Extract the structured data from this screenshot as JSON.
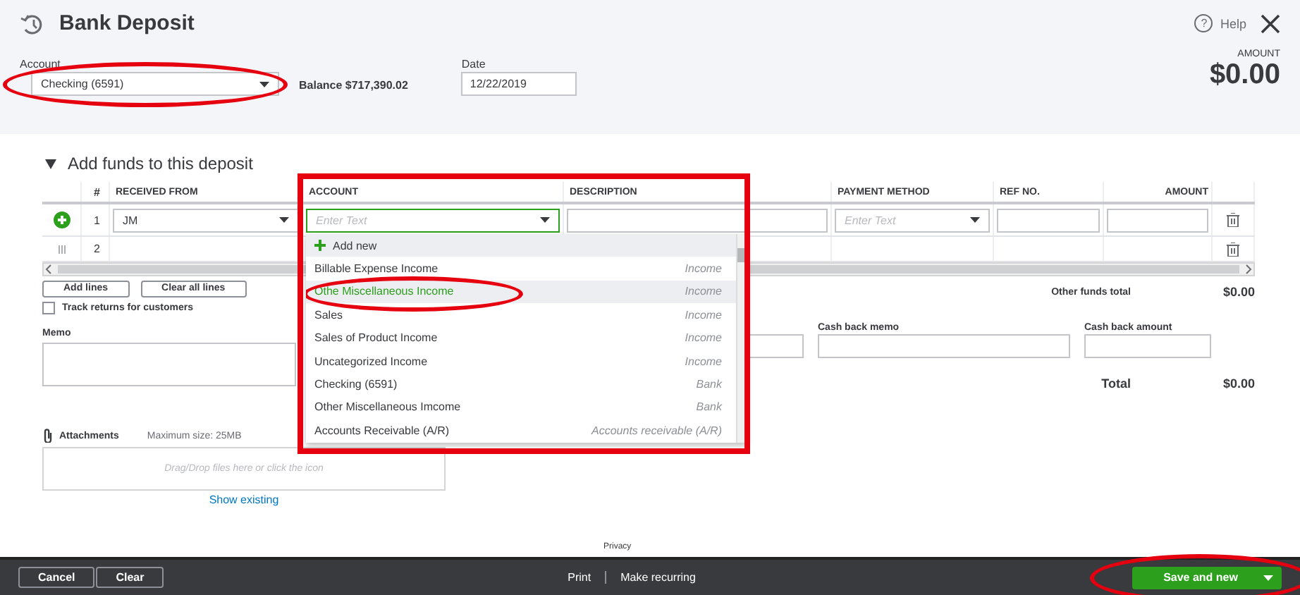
{
  "window": {
    "title": "Bank Deposit",
    "help_icon": "?",
    "help": "Help"
  },
  "header": {
    "account": {
      "label": "Account",
      "value": "Checking (6591)",
      "highlighted": true
    },
    "balance": "Balance $717,390.02",
    "date": {
      "label": "Date",
      "value": "12/22/2019"
    },
    "amount": {
      "label": "AMOUNT",
      "value": "$0.00"
    }
  },
  "section": {
    "title": "Add funds to this deposit",
    "expanded": true
  },
  "table": {
    "columns": [
      "#",
      "RECEIVED FROM",
      "ACCOUNT",
      "DESCRIPTION",
      "PAYMENT METHOD",
      "REF NO.",
      "AMOUNT"
    ],
    "rows": [
      {
        "number": "1",
        "received_from": "JM",
        "account_placeholder": "Enter Text",
        "payment_placeholder": "Enter Text",
        "editing": true
      },
      {
        "number": "2",
        "editing": false
      }
    ]
  },
  "dropdown": {
    "items": [
      {
        "kind": "add",
        "label": "Add new",
        "selected": false,
        "highlighted": false
      },
      {
        "kind": "option",
        "label": "Billable Expense Income",
        "type": "Income",
        "selected": false,
        "highlighted": false
      },
      {
        "kind": "option",
        "label": "Othe Miscellaneous Income",
        "type": "Income",
        "selected": true,
        "highlighted": true
      },
      {
        "kind": "option",
        "label": "Sales",
        "type": "Income",
        "selected": false,
        "highlighted": false
      },
      {
        "kind": "option",
        "label": "Sales of Product Income",
        "type": "Income",
        "selected": false,
        "highlighted": false
      },
      {
        "kind": "option",
        "label": "Uncategorized Income",
        "type": "Income",
        "selected": false,
        "highlighted": false
      },
      {
        "kind": "option",
        "label": "Checking (6591)",
        "type": "Bank",
        "selected": false,
        "highlighted": false
      },
      {
        "kind": "option",
        "label": "Other Miscellaneous Imcome",
        "type": "Bank",
        "selected": false,
        "highlighted": false
      },
      {
        "kind": "option",
        "label": "Accounts Receivable (A/R)",
        "type": "Accounts receivable (A/R)",
        "selected": false,
        "highlighted": false
      }
    ]
  },
  "actions": {
    "add_lines": "Add lines",
    "clear_lines": "Clear all lines",
    "track_returns": {
      "label": "Track returns for customers",
      "checked": false
    }
  },
  "memo": {
    "label": "Memo"
  },
  "other_funds_total": {
    "label": "Other funds total",
    "value": "$0.00"
  },
  "cash_back": {
    "memo_label": "Cash back memo",
    "amount_label": "Cash back amount"
  },
  "total": {
    "label": "Total",
    "value": "$0.00"
  },
  "attachments": {
    "label": "Attachments",
    "max_size": "Maximum size: 25MB",
    "drop_hint": "Drag/Drop files here or click the icon",
    "show_existing": "Show existing"
  },
  "privacy": "Privacy",
  "footer": {
    "cancel": "Cancel",
    "clear": "Clear",
    "print": "Print",
    "make_recurring": "Make recurring",
    "save": {
      "label": "Save and new",
      "highlighted": true
    }
  }
}
